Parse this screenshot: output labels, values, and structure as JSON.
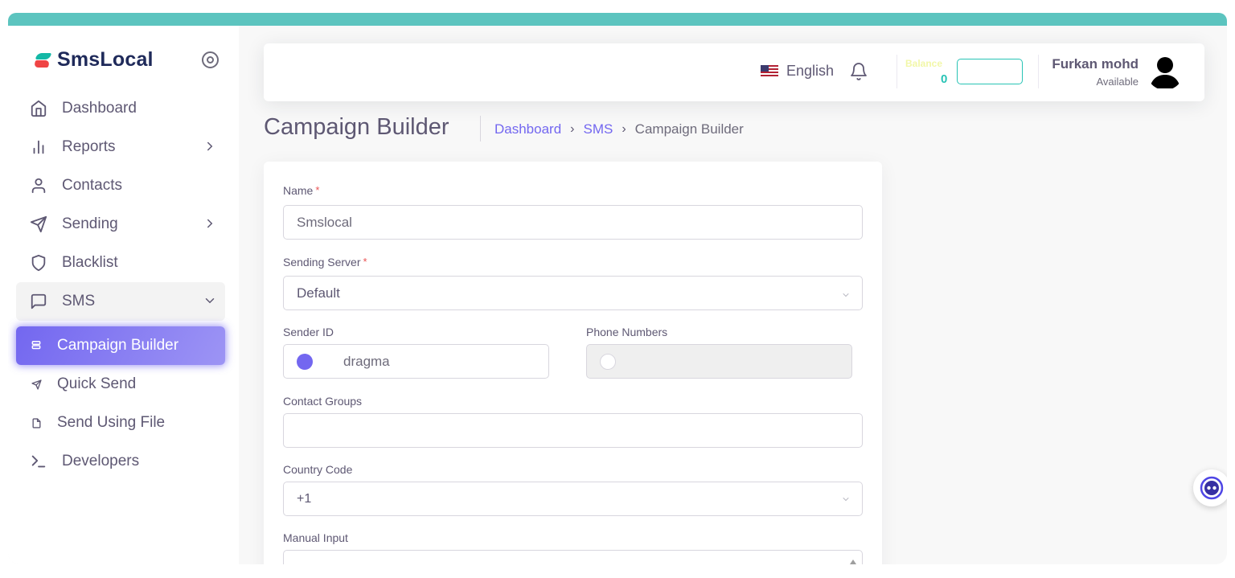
{
  "brand": {
    "name": "SmsLocal"
  },
  "sidebar": {
    "items": [
      {
        "label": "Dashboard",
        "icon": "home-icon"
      },
      {
        "label": "Reports",
        "icon": "bar-chart-icon",
        "has_children": true
      },
      {
        "label": "Contacts",
        "icon": "user-icon"
      },
      {
        "label": "Sending",
        "icon": "send-icon",
        "has_children": true
      },
      {
        "label": "Blacklist",
        "icon": "shield-icon"
      },
      {
        "label": "SMS",
        "icon": "message-square-icon",
        "expanded": true
      },
      {
        "label": "Campaign Builder",
        "icon": "database-icon",
        "active": true
      },
      {
        "label": "Quick Send",
        "icon": "send-icon"
      },
      {
        "label": "Send Using File",
        "icon": "file-icon"
      },
      {
        "label": "Developers",
        "icon": "terminal-icon"
      }
    ]
  },
  "navbar": {
    "language": "English",
    "language_flag": "us-flag-icon",
    "balance_label": "Balance",
    "balance_value": "0",
    "user_name": "Furkan mohd",
    "user_status": "Available"
  },
  "page": {
    "title": "Campaign Builder",
    "breadcrumb": [
      {
        "label": "Dashboard",
        "link": true
      },
      {
        "label": "SMS",
        "link": true
      },
      {
        "label": "Campaign Builder",
        "link": false
      }
    ]
  },
  "form": {
    "name": {
      "label": "Name",
      "required": true,
      "value": "Smslocal"
    },
    "sending_server": {
      "label": "Sending Server",
      "required": true,
      "value": "Default"
    },
    "sender_id": {
      "label": "Sender ID",
      "value": "dragma",
      "selected": true
    },
    "phone_numbers": {
      "label": "Phone Numbers",
      "value": "",
      "selected": false,
      "disabled": true
    },
    "contact_groups": {
      "label": "Contact Groups",
      "value": ""
    },
    "country_code": {
      "label": "Country Code",
      "value": "+1"
    },
    "manual_input": {
      "label": "Manual Input",
      "value": ""
    }
  },
  "colors": {
    "accent": "#7367f0",
    "teal": "#28c3b5",
    "top_strip": "#5cc4bf",
    "required": "#ea5455"
  }
}
